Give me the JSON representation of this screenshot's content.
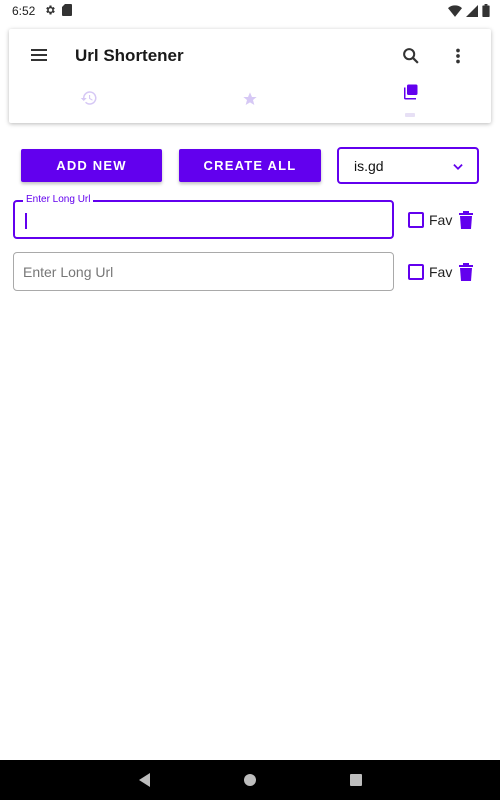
{
  "status_bar": {
    "time": "6:52",
    "left_icons": [
      "settings-icon",
      "sd-card-icon"
    ],
    "right_icons": [
      "wifi-icon",
      "signal-icon",
      "battery-icon"
    ]
  },
  "app_bar": {
    "title": "Url Shortener",
    "menu_icon": "hamburger-menu-icon",
    "actions": [
      "search-icon",
      "more-vert-icon"
    ],
    "tabs": [
      {
        "icon": "history-icon",
        "selected": false
      },
      {
        "icon": "star-icon",
        "selected": false
      },
      {
        "icon": "library-icon",
        "selected": true
      }
    ]
  },
  "actions": {
    "add_new_label": "ADD NEW",
    "create_all_label": "CREATE ALL",
    "service_select": {
      "value": "is.gd"
    }
  },
  "url_rows": [
    {
      "label": "Enter Long Url",
      "value": "",
      "placeholder": "",
      "focused": true,
      "fav_label": "Fav",
      "fav_checked": false
    },
    {
      "label": "",
      "value": "",
      "placeholder": "Enter Long Url",
      "focused": false,
      "fav_label": "Fav",
      "fav_checked": false
    }
  ],
  "colors": {
    "accent": "#6200ee",
    "tab_inactive": "#d6c8f5"
  }
}
